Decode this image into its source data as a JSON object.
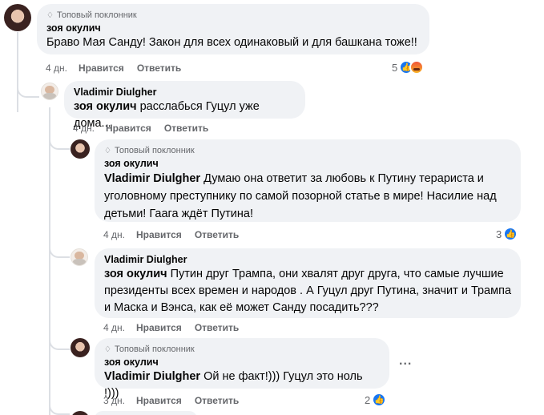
{
  "comments": [
    {
      "badge": "Топовый поклонник",
      "author": "зоя окулич",
      "mention": "",
      "text": "Браво Мая Санду! Закон для всех одинаковый и для башкана тоже!!",
      "time": "4 дн.",
      "like_label": "Нравится",
      "reply_label": "Ответить",
      "reaction_count": "5",
      "reaction_icons": [
        "like-icon",
        "angry-icon"
      ]
    },
    {
      "badge": "",
      "author": "Vladimir Diulgher",
      "mention": "зоя окулич",
      "text": "расслабься Гуцул уже дома...",
      "time": "4 дн.",
      "like_label": "Нравится",
      "reply_label": "Ответить",
      "reaction_count": "",
      "reaction_icons": []
    },
    {
      "badge": "Топовый поклонник",
      "author": "зоя окулич",
      "mention": "Vladimir Diulgher",
      "text": "Думаю она ответит за любовь к Путину терариста и уголовному преступнику по самой позорной статье в мире! Насилие над детьми! Гаага ждёт Путина!",
      "time": "4 дн.",
      "like_label": "Нравится",
      "reply_label": "Ответить",
      "reaction_count": "3",
      "reaction_icons": [
        "like-icon"
      ]
    },
    {
      "badge": "",
      "author": "Vladimir Diulgher",
      "mention": "зоя окулич",
      "text": "Путин друг Трампа, они хвалят друг друга, что самые лучшие президенты всех времен и народов . А Гуцул друг Путина, значит и Трампа и Маска и Вэнса, как её может Санду посадить???",
      "time": "4 дн.",
      "like_label": "Нравится",
      "reply_label": "Ответить",
      "reaction_count": "",
      "reaction_icons": []
    },
    {
      "badge": "Топовый поклонник",
      "author": "зоя окулич",
      "mention": "Vladimir Diulgher",
      "text": "Ой не факт!))) Гуцул это ноль !)))",
      "time": "3 дн.",
      "like_label": "Нравится",
      "reply_label": "Ответить",
      "reaction_count": "2",
      "reaction_icons": [
        "like-icon"
      ]
    }
  ],
  "more_options_label": "...",
  "colors": {
    "bubble": "#f0f2f5",
    "like_blue": "#1877f2",
    "secondary_text": "#65676b"
  }
}
